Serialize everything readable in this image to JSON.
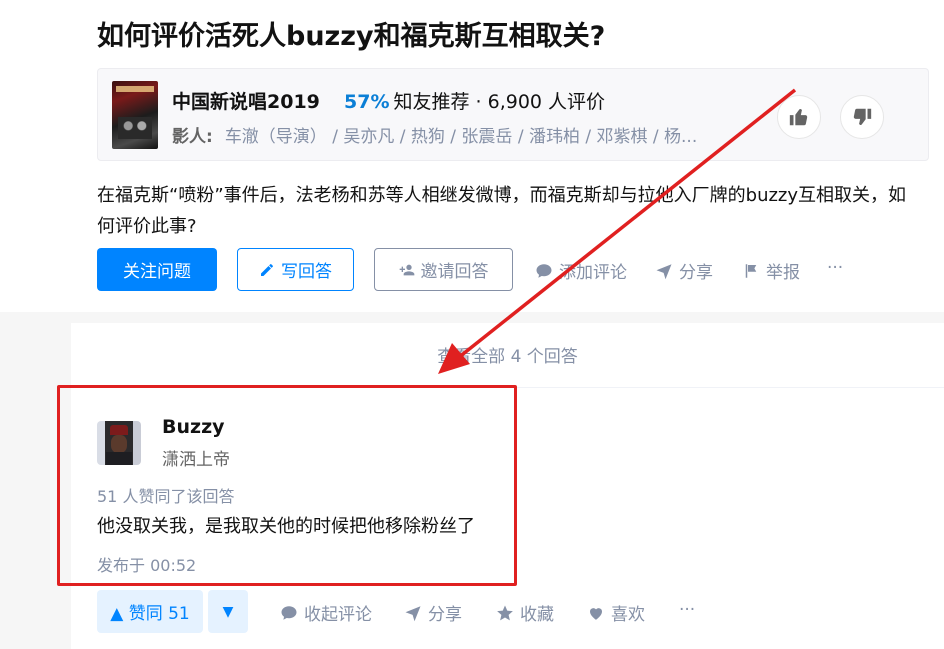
{
  "question": {
    "title": "如何评价活死人buzzy和福克斯互相取关?",
    "description": "在福克斯“喷粉”事件后，法老杨和苏等人相继发微博，而福克斯却与拉他入厂牌的buzzy互相取关，如何评价此事?"
  },
  "show_card": {
    "name": "中国新说唱2019",
    "recommend_pct": "57%",
    "recommend_text": "知友推荐 · 6,900 人评价",
    "cast_label": "影人:",
    "cast": "车澈（导演） / 吴亦凡 / 热狗 / 张震岳 / 潘玮柏 / 邓紫棋 / 杨..."
  },
  "question_actions": {
    "follow": "关注问题",
    "write": "写回答",
    "invite": "邀请回答",
    "comment": "添加评论",
    "share": "分享",
    "report": "举报",
    "more": "···"
  },
  "view_all": "查看全部 4 个回答",
  "answer": {
    "author": "Buzzy",
    "bio": "潇洒上帝",
    "votes_info": "51 人赞同了该回答",
    "content": "他没取关我，是我取关他的时候把他移除粉丝了",
    "published": "发布于 00:52"
  },
  "answer_actions": {
    "upvote": "▲ 赞同 51",
    "downvote": "▼",
    "collapse_comments": "收起评论",
    "share": "分享",
    "collect": "收藏",
    "like": "喜欢",
    "more": "···"
  },
  "colors": {
    "accent": "#0084ff",
    "highlight": "#e02020"
  }
}
